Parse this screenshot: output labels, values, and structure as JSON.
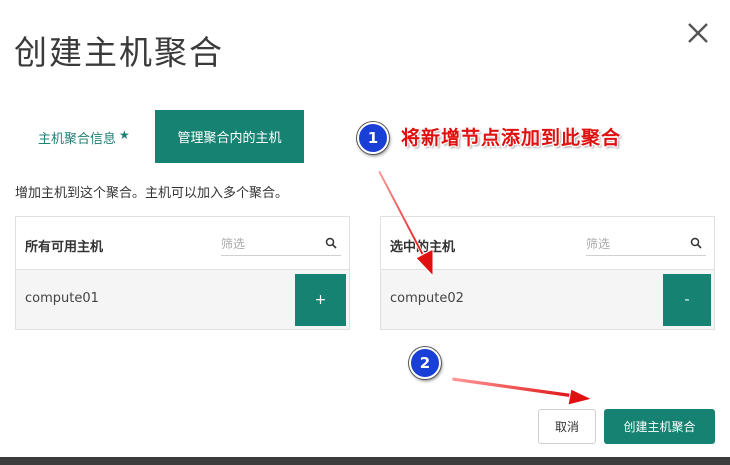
{
  "dialog": {
    "title": "创建主机聚合",
    "close_label": "×"
  },
  "tabs": {
    "info": "主机聚合信息",
    "info_required_mark": "★",
    "manage": "管理聚合内的主机"
  },
  "help_text": "增加主机到这个聚合。主机可以加入多个聚合。",
  "available_hosts": {
    "title": "所有可用主机",
    "filter_placeholder": "筛选",
    "rows": [
      {
        "name": "compute01",
        "action_label": "+"
      }
    ]
  },
  "selected_hosts": {
    "title": "选中的主机",
    "filter_placeholder": "筛选",
    "rows": [
      {
        "name": "compute02",
        "action_label": "-"
      }
    ]
  },
  "footer": {
    "cancel_label": "取消",
    "create_label": "创建主机聚合"
  },
  "annotations": {
    "step1_number": "1",
    "step1_text": "将新增节点添加到此聚合",
    "step2_number": "2",
    "arrow_color": "#e01010",
    "circle_color": "#1a3fd6"
  },
  "colors": {
    "accent": "#168272"
  }
}
